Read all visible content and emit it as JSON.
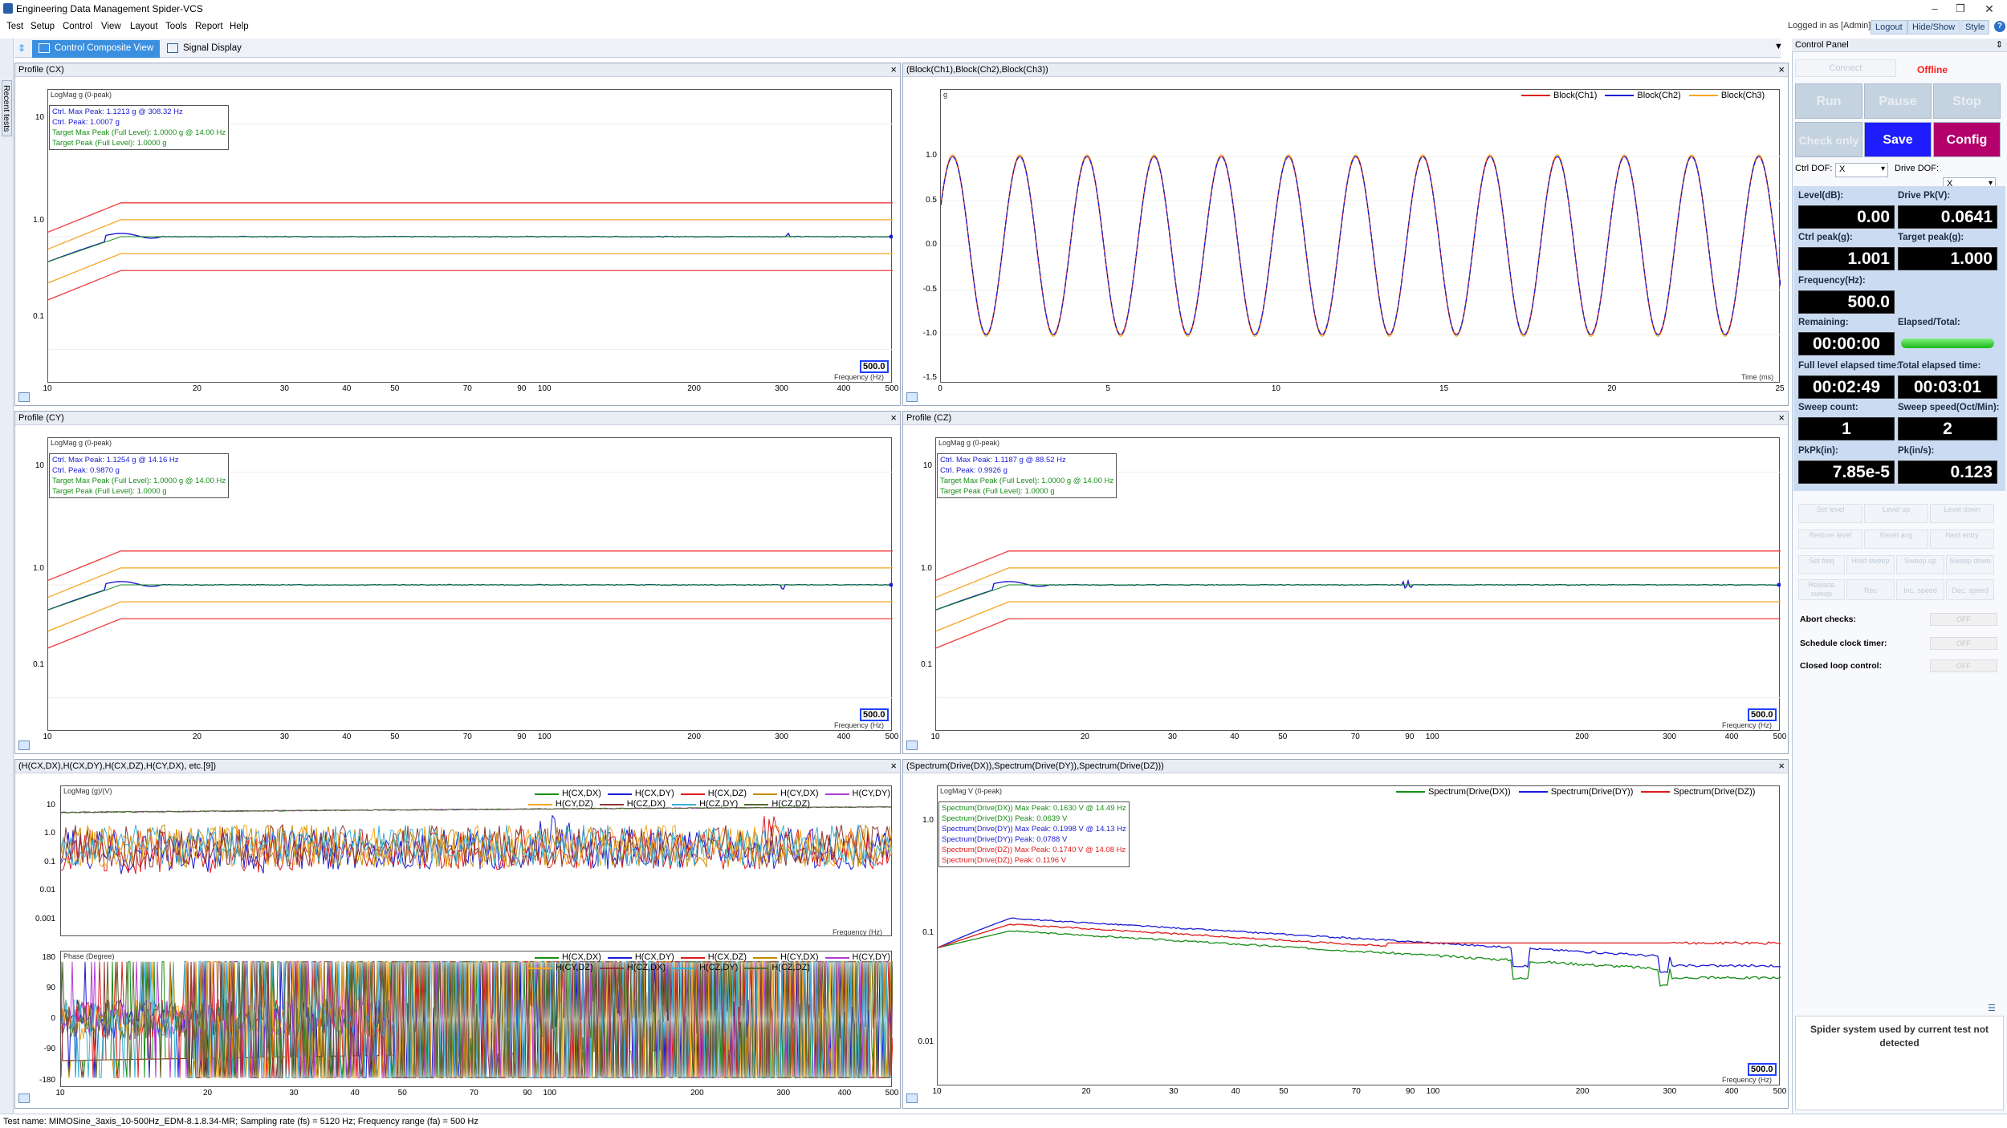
{
  "window": {
    "title": "Engineering Data Management Spider-VCS"
  },
  "menu": [
    "Test",
    "Setup",
    "Control",
    "View",
    "Layout",
    "Tools",
    "Report",
    "Help"
  ],
  "topright": {
    "logged_in": "Logged in as [Admin]",
    "logout": "Logout",
    "hide_show": "Hide/Show",
    "style": "Style"
  },
  "lefttab": {
    "label": "Recent tests"
  },
  "tabs": [
    {
      "label": "Control Composite View"
    },
    {
      "label": "Signal Display"
    }
  ],
  "panels": {
    "cx": {
      "title": "Profile (CX)",
      "ylabel": "LogMag g (0-peak)",
      "xlabel": "Frequency (Hz)",
      "value": "500.0",
      "info": [
        "Ctrl. Max Peak: 1.1213 g @ 308.32 Hz",
        "Ctrl. Peak: 1.0007 g",
        "Target Max Peak (Full Level): 1.0000 g @ 14.00 Hz",
        "Target Peak (Full Level): 1.0000 g"
      ]
    },
    "block": {
      "title": "(Block(Ch1),Block(Ch2),Block(Ch3))",
      "ylabel": "g",
      "xlabel": "Time (ms)",
      "legend": [
        "Block(Ch1)",
        "Block(Ch2)",
        "Block(Ch3)"
      ]
    },
    "cy": {
      "title": "Profile (CY)",
      "ylabel": "LogMag g (0-peak)",
      "xlabel": "Frequency (Hz)",
      "value": "500.0",
      "info": [
        "Ctrl. Max Peak: 1.1254 g @ 14.16 Hz",
        "Ctrl. Peak: 0.9870 g",
        "Target Max Peak (Full Level): 1.0000 g @ 14.00 Hz",
        "Target Peak (Full Level): 1.0000 g"
      ]
    },
    "cz": {
      "title": "Profile (CZ)",
      "ylabel": "LogMag g (0-peak)",
      "xlabel": "Frequency (Hz)",
      "value": "500.0",
      "info": [
        "Ctrl. Max Peak: 1.1187 g @ 88.52 Hz",
        "Ctrl. Peak: 0.9926 g",
        "Target Max Peak (Full Level): 1.0000 g @ 14.00 Hz",
        "Target Peak (Full Level): 1.0000 g"
      ]
    },
    "h": {
      "title": "(H(CX,DX),H(CX,DY),H(CX,DZ),H(CY,DX), etc.[9])",
      "ylabel": "LogMag (g)/(V)",
      "ylabel2": "Phase (Degree)",
      "xlabel": "Frequency (Hz)",
      "legend": [
        "H(CX,DX)",
        "H(CX,DY)",
        "H(CX,DZ)",
        "H(CY,DX)",
        "H(CY,DY)",
        "H(CY,DZ)",
        "H(CZ,DX)",
        "H(CZ,DY)",
        "H(CZ,DZ)"
      ]
    },
    "spec": {
      "title": "(Spectrum(Drive(DX)),Spectrum(Drive(DY)),Spectrum(Drive(DZ)))",
      "ylabel": "LogMag V (0-peak)",
      "xlabel": "Frequency (Hz)",
      "value": "500.0",
      "legend": [
        "Spectrum(Drive(DX))",
        "Spectrum(Drive(DY))",
        "Spectrum(Drive(DZ))"
      ],
      "info": [
        "Spectrum(Drive(DX)) Max Peak: 0.1630 V @ 14.49 Hz",
        "Spectrum(Drive(DX)) Peak: 0.0639 V",
        "Spectrum(Drive(DY)) Max Peak: 0.1998 V @ 14.13 Hz",
        "Spectrum(Drive(DY)) Peak: 0.0788 V",
        "Spectrum(Drive(DZ)) Max Peak: 0.1740 V @ 14.08 Hz",
        "Spectrum(Drive(DZ)) Peak: 0.1196 V"
      ]
    }
  },
  "ticks": {
    "freq": [
      "10",
      "20",
      "30",
      "40",
      "50",
      "70",
      "90",
      "100",
      "200",
      "300",
      "400",
      "500"
    ],
    "profile_y": [
      "10",
      "1.0",
      "0.1"
    ],
    "block_x": [
      "0",
      "5",
      "10",
      "15",
      "20",
      "25"
    ],
    "block_y": [
      "1.0",
      "0.5",
      "0.0",
      "-0.5",
      "-1.0",
      "-1.5"
    ],
    "h_mag_y": [
      "10",
      "1.0",
      "0.1",
      "0.01",
      "0.001"
    ],
    "h_phase_y": [
      "180",
      "90",
      "0",
      "-90",
      "-180"
    ],
    "spec_y": [
      "1.0",
      "0.1",
      "0.01"
    ]
  },
  "control": {
    "title": "Control Panel",
    "connect": "Connect",
    "status": "Offline",
    "run": "Run",
    "pause": "Pause",
    "stop": "Stop",
    "check_only": "Check only",
    "save": "Save",
    "config": "Config",
    "ctrl_dof_label": "Ctrl DOF:",
    "ctrl_dof": "X",
    "drive_dof_label": "Drive DOF:",
    "drive_dof": "X",
    "level_label": "Level(dB):",
    "level": "0.00",
    "drive_pk_label": "Drive Pk(V):",
    "drive_pk": "0.0641",
    "ctrl_peak_label": "Ctrl peak(g):",
    "ctrl_peak": "1.001",
    "target_peak_label": "Target peak(g):",
    "target_peak": "1.000",
    "freq_label": "Frequency(Hz):",
    "freq": "500.0",
    "remaining_label": "Remaining:",
    "remaining": "00:00:00",
    "elapsed_label": "Elapsed/Total:",
    "elapsed_progress": 1.0,
    "full_elapsed_label": "Full level elapsed time:",
    "full_elapsed": "00:02:49",
    "total_elapsed_label": "Total elapsed time:",
    "total_elapsed": "00:03:01",
    "sweep_count_label": "Sweep count:",
    "sweep_count": "1",
    "sweep_speed_label": "Sweep speed(Oct/Min):",
    "sweep_speed": "2",
    "pkpk_label": "PkPk(in):",
    "pkpk": "7.85e-5",
    "pk_label": "Pk(in/s):",
    "pk": "0.123",
    "small_buttons": [
      "Set level",
      "Level up",
      "Level down",
      "Restore level",
      "Reset avg",
      "Next entry",
      "Set freq",
      "Hold sweep",
      "Sweep up",
      "Sweep down",
      "Release sweep",
      "Rec",
      "Inc. speed",
      "Dec. speed"
    ],
    "abort_label": "Abort checks:",
    "schedule_label": "Schedule clock timer:",
    "closed_loop_label": "Closed loop control:",
    "off": "OFF",
    "message": "Spider system used by current test not detected"
  },
  "statusbar": {
    "text": "Test name: MIMOSine_3axis_10-500Hz_EDM-8.1.8.34-MR; Sampling rate (fs) = 5120 Hz; Frequency range (fa) = 500 Hz"
  },
  "colors": {
    "accent": "#3a8fe0",
    "save": "#1d1dff",
    "config": "#b3006b",
    "offline": "#ff1e1e",
    "ctrl": "#1a1ad6",
    "target_band_red": "#f03c3c",
    "target_band_orange": "#f5a623",
    "green": "#178d17"
  }
}
